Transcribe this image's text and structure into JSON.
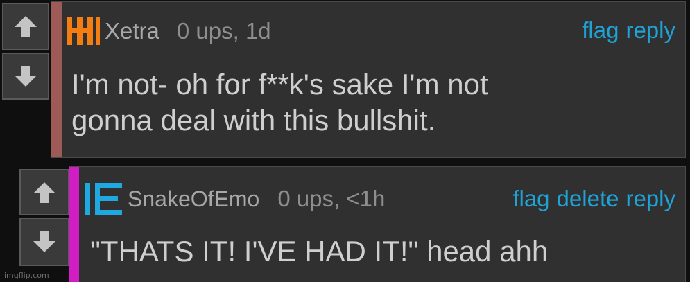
{
  "comments": [
    {
      "username": "Xetra",
      "meta": "0 ups, 1d",
      "actions": [
        "flag",
        "reply"
      ],
      "body": "I'm not- oh for f**k's sake I'm not\ngonna deal with this bullshit.",
      "stripe_color": "#9e5a57",
      "avatar_color": "#f57e12"
    },
    {
      "username": "SnakeOfEmo",
      "meta": "0 ups, <1h",
      "actions": [
        "flag",
        "delete",
        "reply"
      ],
      "body": "\"THATS IT! I'VE HAD IT!\" head ahh",
      "stripe_color": "#d01ec4",
      "avatar_color": "#1fa9e0"
    }
  ],
  "watermark": "imgflip.com",
  "colors": {
    "link": "#1fa3d6",
    "card_bg": "#303030",
    "page_bg": "#0f0f0f"
  }
}
